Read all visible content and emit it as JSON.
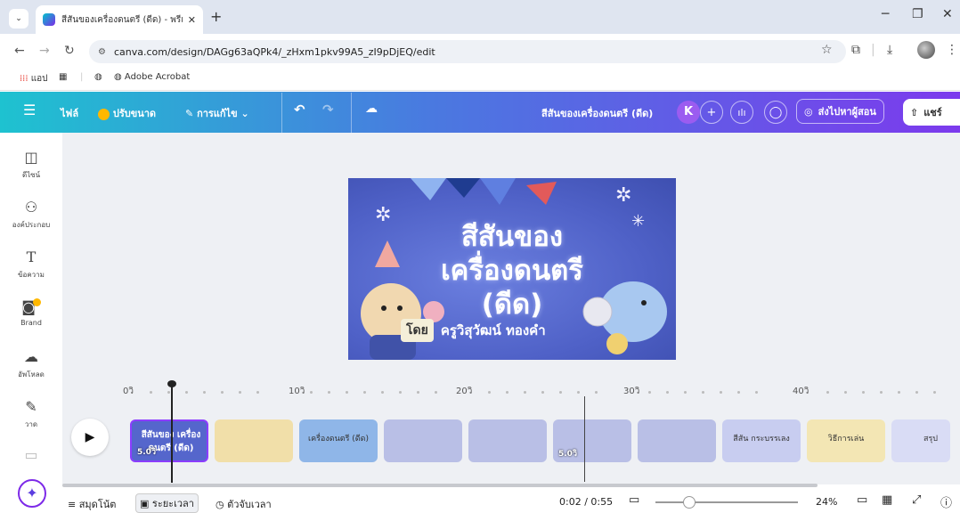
{
  "browser": {
    "tab_title": "สีสันของเครื่องดนตรี (ดีด) - พรีเซนเ",
    "url": "canva.com/design/DAGg63aQPk4/_zHxm1pkv99A5_zI9pDjEQ/edit",
    "bookmarks": {
      "apps": "แอป",
      "adobe": "Adobe Acrobat"
    }
  },
  "toolbar": {
    "file": "ไฟล์",
    "resize": "ปรับขนาด",
    "editing": "การแก้ไข",
    "design_title": "สีสันของเครื่องดนตรี (ดีด)",
    "avatar_letter": "K",
    "send_teacher": "ส่งไปหาผู้สอน",
    "share": "แชร์",
    "accent": "#7d2ae8"
  },
  "sidebar": {
    "items": [
      {
        "label": "ดีไซน์",
        "icon": "template-icon"
      },
      {
        "label": "องค์ประกอบ",
        "icon": "elements-icon"
      },
      {
        "label": "ข้อความ",
        "icon": "text-icon"
      },
      {
        "label": "Brand",
        "icon": "brand-icon"
      },
      {
        "label": "อัพโหลด",
        "icon": "upload-icon"
      },
      {
        "label": "วาด",
        "icon": "draw-icon"
      }
    ]
  },
  "slide": {
    "title_line1": "สีสันของ",
    "title_line2": "เครื่องดนตรี",
    "title_line3": "(ดีด)",
    "by": "โดย",
    "author": "ครูวิสุวัฒน์ ทองคำ"
  },
  "timeline": {
    "ruler": [
      "0วิ",
      "10วิ",
      "20วิ",
      "30วิ",
      "40วิ"
    ],
    "thumbs": [
      {
        "text": "สีสันของ เครื่องดนตรี (ดีด)",
        "duration": "5.0วิ",
        "bg": "#5566cc"
      },
      {
        "text": "",
        "duration": "",
        "bg": "#f1dfa9"
      },
      {
        "text": "เครื่องดนตรี (ดีด)",
        "duration": "",
        "bg": "#8fb6e8"
      },
      {
        "text": "",
        "duration": "",
        "bg": "#b9bfe6"
      },
      {
        "text": "",
        "duration": "",
        "bg": "#b9bfe6"
      },
      {
        "text": "",
        "duration": "5.0วิ",
        "bg": "#b9bfe6"
      },
      {
        "text": "",
        "duration": "",
        "bg": "#b9bfe6"
      },
      {
        "text": "สีสัน กระบรรเลง",
        "duration": "",
        "bg": "#c8cdf0"
      },
      {
        "text": "วิธีการเล่น",
        "duration": "",
        "bg": "#f3e6b4"
      },
      {
        "text": "สรุป",
        "duration": "",
        "bg": "#d9dcf5"
      }
    ]
  },
  "bottombar": {
    "notes": "สมุดโน้ต",
    "duration": "ระยะเวลา",
    "timer": "ตัวจับเวลา",
    "time": "0:02 / 0:55",
    "zoom": "24%",
    "zoom_fraction": 0.24
  }
}
